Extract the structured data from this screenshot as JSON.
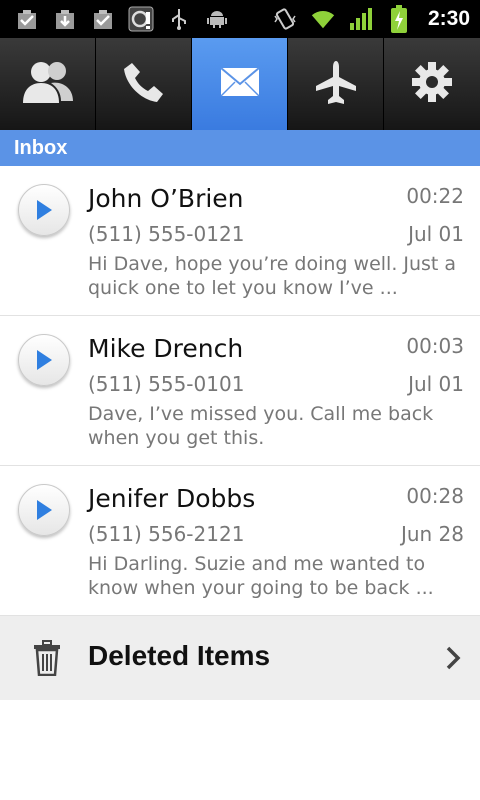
{
  "status_bar": {
    "time": "2:30",
    "left_icons": [
      "task-icon",
      "download-icon",
      "task-icon",
      "sync-alert-icon",
      "usb-icon",
      "android-debug-icon"
    ],
    "right_icons": [
      "vibrate-icon",
      "wifi-icon",
      "signal-icon",
      "battery-charging-icon"
    ]
  },
  "tabs": [
    {
      "name": "contacts",
      "icon": "contacts-icon",
      "active": false
    },
    {
      "name": "phone",
      "icon": "phone-icon",
      "active": false
    },
    {
      "name": "messages",
      "icon": "envelope-icon",
      "active": true
    },
    {
      "name": "airplane",
      "icon": "airplane-icon",
      "active": false
    },
    {
      "name": "settings",
      "icon": "gear-icon",
      "active": false
    }
  ],
  "section": {
    "title": "Inbox"
  },
  "messages": [
    {
      "name": "John O’Brien",
      "duration": "00:22",
      "phone": "(511) 555-0121",
      "date": "Jul 01",
      "preview": "Hi Dave, hope you’re doing well. Just a quick one to let you know I’ve ..."
    },
    {
      "name": "Mike Drench",
      "duration": "00:03",
      "phone": "(511) 555-0101",
      "date": "Jul 01",
      "preview": "Dave, I’ve missed you. Call me back when you get this."
    },
    {
      "name": "Jenifer Dobbs",
      "duration": "00:28",
      "phone": "(511) 556-2121",
      "date": "Jun 28",
      "preview": "Hi Darling. Suzie and me wanted to know when your going to be back ..."
    }
  ],
  "deleted": {
    "label": "Deleted Items"
  },
  "colors": {
    "accent": "#5b93e6",
    "active_tab": "#4a8ae8",
    "play_arrow": "#2f7fe0",
    "muted_text": "#777777"
  }
}
